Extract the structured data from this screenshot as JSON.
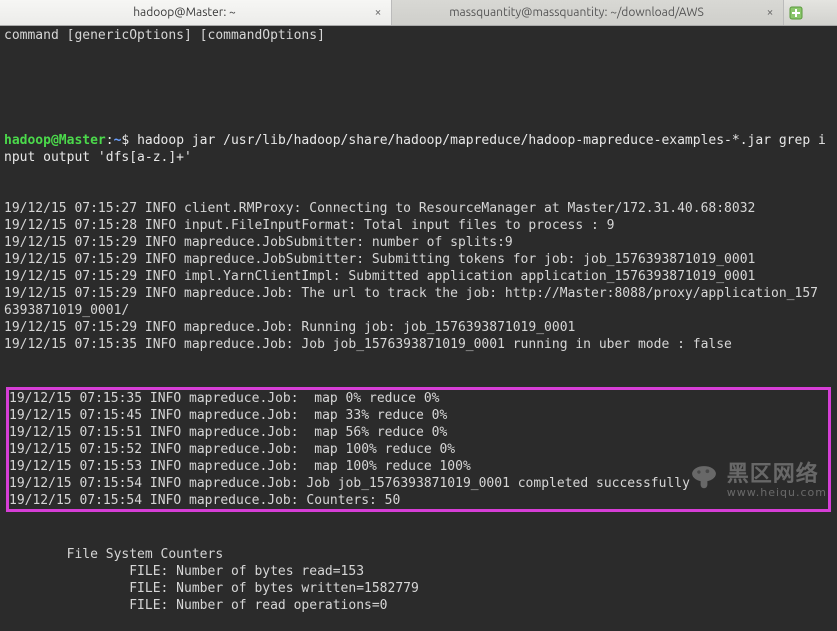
{
  "tabs": {
    "active": "hadoop@Master: ~",
    "inactive": "massquantity@massquantity: ~/download/AWS"
  },
  "menubar": "command [genericOptions] [commandOptions]",
  "prompt": {
    "userhost": "hadoop@Master",
    "sep": ":",
    "path": "~",
    "dollar": "$",
    "command": "hadoop jar /usr/lib/hadoop/share/hadoop/mapreduce/hadoop-mapreduce-examples-*.jar grep input output 'dfs[a-z.]+'"
  },
  "pre_lines": [
    "19/12/15 07:15:27 INFO client.RMProxy: Connecting to ResourceManager at Master/172.31.40.68:8032",
    "19/12/15 07:15:28 INFO input.FileInputFormat: Total input files to process : 9",
    "19/12/15 07:15:29 INFO mapreduce.JobSubmitter: number of splits:9",
    "19/12/15 07:15:29 INFO mapreduce.JobSubmitter: Submitting tokens for job: job_1576393871019_0001",
    "19/12/15 07:15:29 INFO impl.YarnClientImpl: Submitted application application_1576393871019_0001",
    "19/12/15 07:15:29 INFO mapreduce.Job: The url to track the job: http://Master:8088/proxy/application_1576393871019_0001/",
    "19/12/15 07:15:29 INFO mapreduce.Job: Running job: job_1576393871019_0001",
    "19/12/15 07:15:35 INFO mapreduce.Job: Job job_1576393871019_0001 running in uber mode : false"
  ],
  "boxed_lines": [
    "19/12/15 07:15:35 INFO mapreduce.Job:  map 0% reduce 0%",
    "19/12/15 07:15:45 INFO mapreduce.Job:  map 33% reduce 0%",
    "19/12/15 07:15:51 INFO mapreduce.Job:  map 56% reduce 0%",
    "19/12/15 07:15:52 INFO mapreduce.Job:  map 100% reduce 0%",
    "19/12/15 07:15:53 INFO mapreduce.Job:  map 100% reduce 100%",
    "19/12/15 07:15:54 INFO mapreduce.Job: Job job_1576393871019_0001 completed successfully",
    "19/12/15 07:15:54 INFO mapreduce.Job: Counters: 50"
  ],
  "post_lines": [
    "        File System Counters",
    "                FILE: Number of bytes read=153",
    "                FILE: Number of bytes written=1582779",
    "                FILE: Number of read operations=0"
  ],
  "watermark": {
    "big": "黑区网络",
    "small": "www.heiqu.com"
  }
}
